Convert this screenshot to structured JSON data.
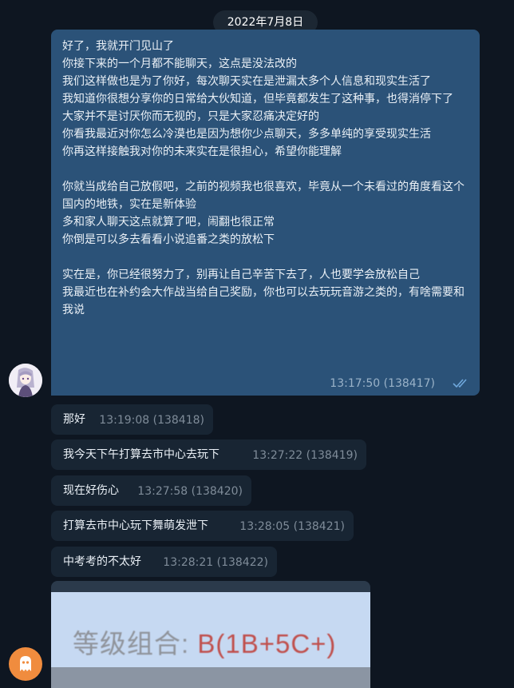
{
  "date": "2022年7月8日",
  "outgoing": {
    "text": "好了，我就开门见山了\n你接下来的一个月都不能聊天，这点是没法改的\n我们这样做也是为了你好，每次聊天实在是泄漏太多个人信息和现实生活了\n我知道你很想分享你的日常给大伙知道，但毕竟都发生了这种事，也得消停下了\n大家并不是讨厌你而无视的，只是大家忍痛决定好的\n你看我最近对你怎么冷漠也是因为想你少点聊天，多多单纯的享受现实生活\n你再这样接触我对你的未来实在是很担心，希望你能理解\n\n你就当成给自己放假吧，之前的视频我也很喜欢，毕竟从一个未看过的角度看这个国内的地铁，实在是新体验\n多和家人聊天这点就算了吧，闹翻也很正常\n你倒是可以多去看看小说追番之类的放松下\n\n实在是，你已经很努力了，别再让自己辛苦下去了，人也要学会放松自己\n我最近也在补约会大作战当给自己奖励，你也可以去玩玩音游之类的，有啥需要和我说",
    "meta": "13:17:50 (138417)",
    "status_icon": "double-check-icon"
  },
  "incoming": [
    {
      "text": "那好",
      "meta": "13:19:08 (138418)"
    },
    {
      "text": "我今天下午打算去市中心去玩下",
      "meta": "13:27:22 (138419)"
    },
    {
      "text": "现在好伤心",
      "meta": "13:27:58 (138420)"
    },
    {
      "text": "打算去市中心玩下舞萌发泄下",
      "meta": "13:28:05 (138421)"
    },
    {
      "text": "中考考的不太好",
      "meta": "13:28:21 (138422)"
    }
  ],
  "image_message": {
    "label_prefix": "等级组合: ",
    "label_grade": "B(1B+5C+)"
  },
  "colors": {
    "background": "#0e1621",
    "outgoing_bubble": "#2b5278",
    "incoming_bubble": "#182533",
    "avatar_bottom": "#f08c3e"
  }
}
